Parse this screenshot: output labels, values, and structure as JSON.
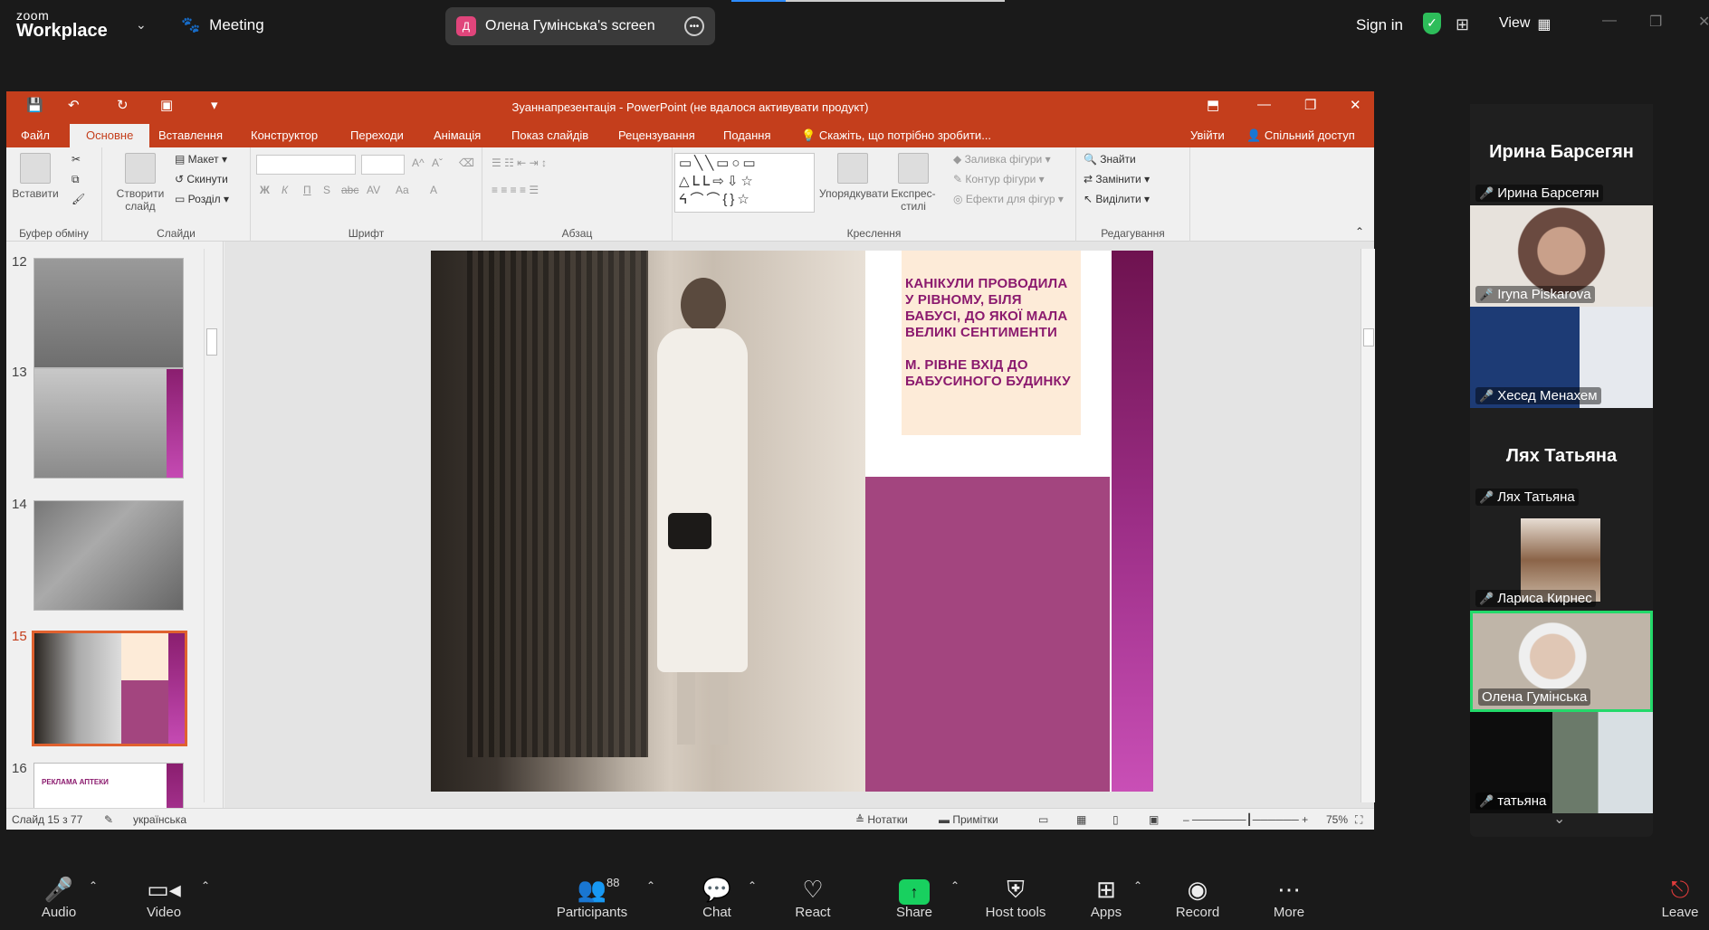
{
  "zoom": {
    "logo_top": "zoom",
    "logo_bottom": "Workplace",
    "meeting_label": "Meeting",
    "screen_badge": "Д",
    "screen_label": "Олена Гумінська's screen",
    "signin": "Sign in",
    "view": "View",
    "colors": {
      "accent": "#2d8cff",
      "share": "#18d05f",
      "mic_off": "#e23c3c",
      "speaking": "#23d96a"
    }
  },
  "ppt": {
    "title": "Зуаннапрезентація - PowerPoint (не вдалося активувати продукт)",
    "tabs": [
      "Файл",
      "Основне",
      "Вставлення",
      "Конструктор",
      "Переходи",
      "Анімація",
      "Показ слайдів",
      "Рецензування",
      "Подання"
    ],
    "tell_me": "Скажіть, що потрібно зробити...",
    "signin": "Увійти",
    "share": "Спільний доступ",
    "ribbon": {
      "paste": "Вставити",
      "clipboard_group": "Буфер обміну",
      "new_slide_line1": "Створити",
      "new_slide_line2": "слайд",
      "layout": "Макет",
      "reset": "Скинути",
      "section": "Розділ",
      "slides_group": "Слайди",
      "font_group": "Шрифт",
      "paragraph_group": "Абзац",
      "arrange": "Упорядкувати",
      "quick_styles_line1": "Експрес-",
      "quick_styles_line2": "стилі",
      "shape_fill": "Заливка фігури",
      "shape_outline": "Контур фігури",
      "shape_effects": "Ефекти для фігур",
      "drawing_group": "Креслення",
      "find": "Знайти",
      "replace": "Замінити",
      "select": "Виділити",
      "editing_group": "Редагування",
      "font_buttons": [
        "Ж",
        "К",
        "П",
        "S",
        "abc",
        "AV",
        "Aa",
        "A"
      ]
    },
    "thumbnails": [
      {
        "num": "12",
        "active": false
      },
      {
        "num": "13",
        "active": false
      },
      {
        "num": "14",
        "active": false
      },
      {
        "num": "15",
        "active": true
      },
      {
        "num": "16",
        "active": false
      }
    ],
    "thumb16_text": "РЕКЛАМА АПТЕКИ",
    "slide": {
      "text_line1": "КАНІКУЛИ ПРОВОДИЛА У РІВНОМУ, БІЛЯ БАБУСІ, ДО ЯКОЇ МАЛА ВЕЛИКІ СЕНТИМЕНТИ",
      "text_line2": "М. РІВНЕ ВХІД ДО БАБУСИНОГО БУДИНКУ",
      "text_color": "#8b1a6e",
      "accent_color": "#a3457f"
    },
    "status": {
      "slide_of": "Слайд 15 з 77",
      "language": "українська",
      "notes": "Нотатки",
      "comments": "Примітки",
      "zoom": "75%"
    }
  },
  "participants": [
    {
      "big_name": "Ирина Барсегян",
      "name": "Ирина Барсегян",
      "muted": true,
      "video": false
    },
    {
      "name": "Iryna Piskarova",
      "muted": true,
      "video": true
    },
    {
      "name": "Хесед Менахем",
      "muted": true,
      "video": true
    },
    {
      "big_name": "Лях Татьяна",
      "name": "Лях Татьяна",
      "muted": true,
      "video": false
    },
    {
      "name": "Лариса Кирнес",
      "muted": true,
      "video": true
    },
    {
      "name": "Олена Гумінська",
      "muted": false,
      "video": true,
      "speaking": true
    },
    {
      "name": "татьяна",
      "muted": true,
      "video": true
    }
  ],
  "toolbar": {
    "audio": "Audio",
    "video": "Video",
    "participants": "Participants",
    "participants_count": "88",
    "chat": "Chat",
    "react": "React",
    "share": "Share",
    "host_tools": "Host tools",
    "apps": "Apps",
    "record": "Record",
    "more": "More",
    "leave": "Leave"
  }
}
